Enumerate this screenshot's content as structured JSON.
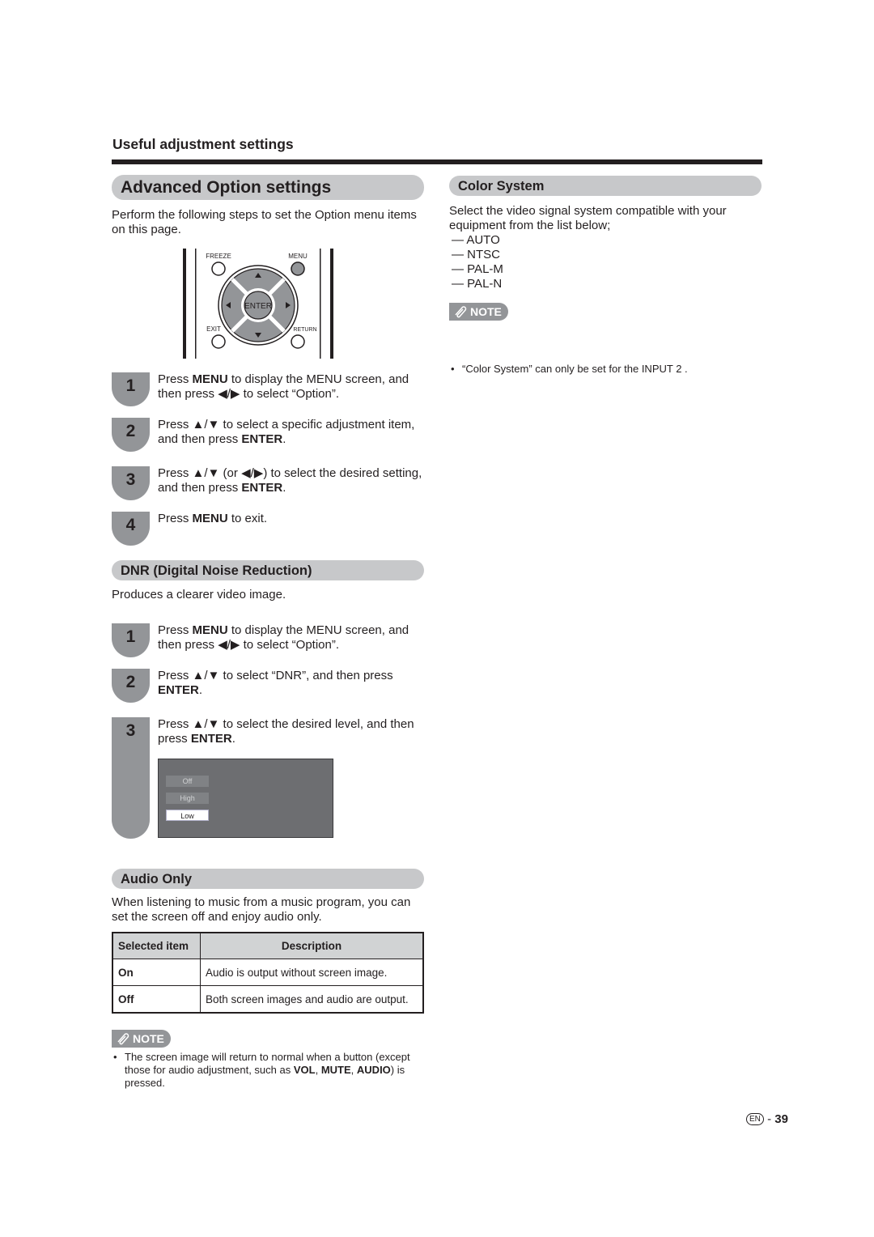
{
  "section_label": "Useful adjustment settings",
  "advanced": {
    "title": "Advanced Option settings",
    "intro": "Perform the following steps to set the Option menu items on this page.",
    "remote": {
      "buttons": {
        "freeze": "FREEZE",
        "menu": "MENU",
        "exit": "EXIT",
        "return": "RETURN",
        "enter": "ENTER"
      }
    },
    "steps": [
      {
        "num": "1",
        "parts": [
          [
            "Press ",
            false
          ],
          [
            "MENU",
            true
          ],
          [
            " to display the MENU screen, and then press ",
            false
          ],
          [
            "◀/▶",
            false
          ],
          [
            " to select “Option”.",
            false
          ]
        ]
      },
      {
        "num": "2",
        "parts": [
          [
            "Press ",
            false
          ],
          [
            "▲/▼",
            false
          ],
          [
            " to select a specific adjustment item, and then press ",
            false
          ],
          [
            "ENTER",
            true
          ],
          [
            ".",
            false
          ]
        ]
      },
      {
        "num": "3",
        "parts": [
          [
            "Press ",
            false
          ],
          [
            "▲/▼",
            false
          ],
          [
            " (or ",
            false
          ],
          [
            "◀/▶",
            false
          ],
          [
            ") to select the desired setting, and then press ",
            false
          ],
          [
            "ENTER",
            true
          ],
          [
            ".",
            false
          ]
        ]
      },
      {
        "num": "4",
        "parts": [
          [
            "Press ",
            false
          ],
          [
            "MENU",
            true
          ],
          [
            " to exit.",
            false
          ]
        ]
      }
    ]
  },
  "dnr": {
    "title": "DNR (Digital Noise Reduction)",
    "intro": "Produces a clearer video image.",
    "steps": [
      {
        "num": "1",
        "parts": [
          [
            "Press ",
            false
          ],
          [
            "MENU",
            true
          ],
          [
            " to display the MENU screen, and then press ",
            false
          ],
          [
            "◀/▶",
            false
          ],
          [
            " to select “Option”.",
            false
          ]
        ]
      },
      {
        "num": "2",
        "parts": [
          [
            "Press ",
            false
          ],
          [
            "▲/▼",
            false
          ],
          [
            " to select “DNR”, and then press ",
            false
          ],
          [
            "ENTER",
            true
          ],
          [
            ".",
            false
          ]
        ]
      },
      {
        "num": "3",
        "parts": [
          [
            "Press ",
            false
          ],
          [
            "▲/▼",
            false
          ],
          [
            " to select the desired level, and then press ",
            false
          ],
          [
            "ENTER",
            true
          ],
          [
            ".",
            false
          ]
        ]
      }
    ],
    "osd_options": [
      {
        "label": "Off",
        "selected": false
      },
      {
        "label": "High",
        "selected": false
      },
      {
        "label": "Low",
        "selected": true
      }
    ]
  },
  "audio_only": {
    "title": "Audio Only",
    "intro": "When listening to music from a music program, you can set the screen off and enjoy audio only.",
    "table": {
      "headers": [
        "Selected item",
        "Description"
      ],
      "rows": [
        [
          "On",
          "Audio is output without screen image."
        ],
        [
          "Off",
          "Both screen images and audio are output."
        ]
      ]
    },
    "note_label": "NOTE",
    "note_parts": [
      [
        "The screen image will return to normal when a button (except those for audio adjustment, such as ",
        false
      ],
      [
        "VOL",
        true
      ],
      [
        ", ",
        false
      ],
      [
        "MUTE",
        true
      ],
      [
        ", ",
        false
      ],
      [
        "AUDIO",
        true
      ],
      [
        ") is pressed.",
        false
      ]
    ]
  },
  "color_system": {
    "title": "Color System",
    "intro": "Select the video signal system compatible with your equipment from the list below;",
    "options": [
      "AUTO",
      "NTSC",
      "PAL-M",
      "PAL-N"
    ],
    "note_label": "NOTE",
    "note": "“Color System” can only be set for the INPUT 2 ."
  },
  "footer": {
    "lang": "EN",
    "separator": "-",
    "page": "39"
  }
}
